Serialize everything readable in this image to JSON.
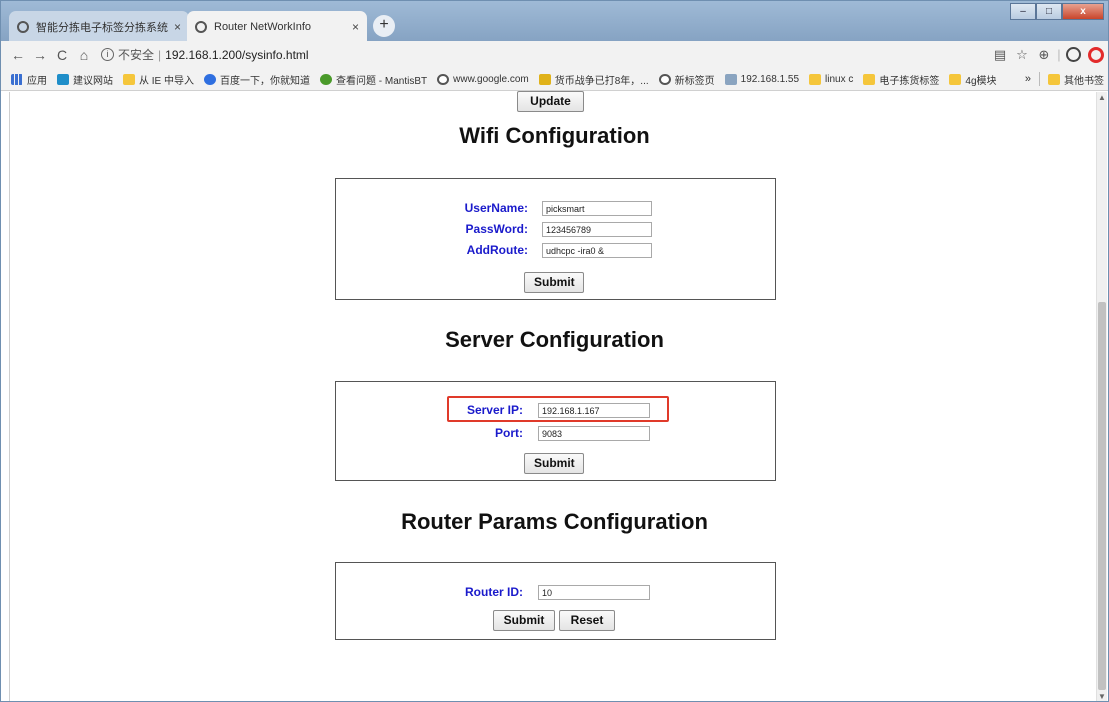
{
  "browser": {
    "tabs": [
      {
        "label": "智能分拣电子标签分拣系统",
        "close": "×"
      },
      {
        "label": "Router NetWorkInfo",
        "close": "×"
      }
    ],
    "new_tab": "+",
    "window_buttons": {
      "minimize": "–",
      "maximize": "□",
      "close": "x"
    },
    "nav": {
      "back": "←",
      "forward": "→",
      "reload": "C",
      "home": "⌂"
    },
    "security_label": "不安全",
    "url": "192.168.1.200/sysinfo.html",
    "bookmarks": [
      {
        "label": "应用",
        "icon": "apps-icon"
      },
      {
        "label": "建议网站",
        "icon": "bing-icon"
      },
      {
        "label": "从 IE 中导入",
        "icon": "folder-icon"
      },
      {
        "label": "百度一下，你就知道",
        "icon": "paw-icon"
      },
      {
        "label": "查看问题 - MantisBT",
        "icon": "bug-icon"
      },
      {
        "label": "www.google.com",
        "icon": "globe-icon"
      },
      {
        "label": "货币战争已打8年，...",
        "icon": "s-icon"
      },
      {
        "label": "新标签页",
        "icon": "globe-icon"
      },
      {
        "label": "192.168.1.55",
        "icon": "image-icon"
      },
      {
        "label": "linux c",
        "icon": "folder-icon"
      },
      {
        "label": "电子拣货标签",
        "icon": "folder-icon"
      },
      {
        "label": "4g模块",
        "icon": "folder-icon"
      }
    ],
    "more_bookmarks": "»",
    "other_bookmarks": "其他书签"
  },
  "page": {
    "update_button": "Update",
    "wifi": {
      "title": "Wifi Configuration",
      "username_label": "UserName:",
      "username_value": "picksmart",
      "password_label": "PassWord:",
      "password_value": "123456789",
      "addroute_label": "AddRoute:",
      "addroute_value": "udhcpc -ira0 &",
      "submit": "Submit"
    },
    "server": {
      "title": "Server Configuration",
      "ip_label": "Server IP:",
      "ip_value": "192.168.1.167",
      "port_label": "Port:",
      "port_value": "9083",
      "submit": "Submit"
    },
    "router": {
      "title": "Router Params Configuration",
      "id_label": "Router ID:",
      "id_value": "10",
      "submit": "Submit",
      "reset": "Reset"
    }
  }
}
